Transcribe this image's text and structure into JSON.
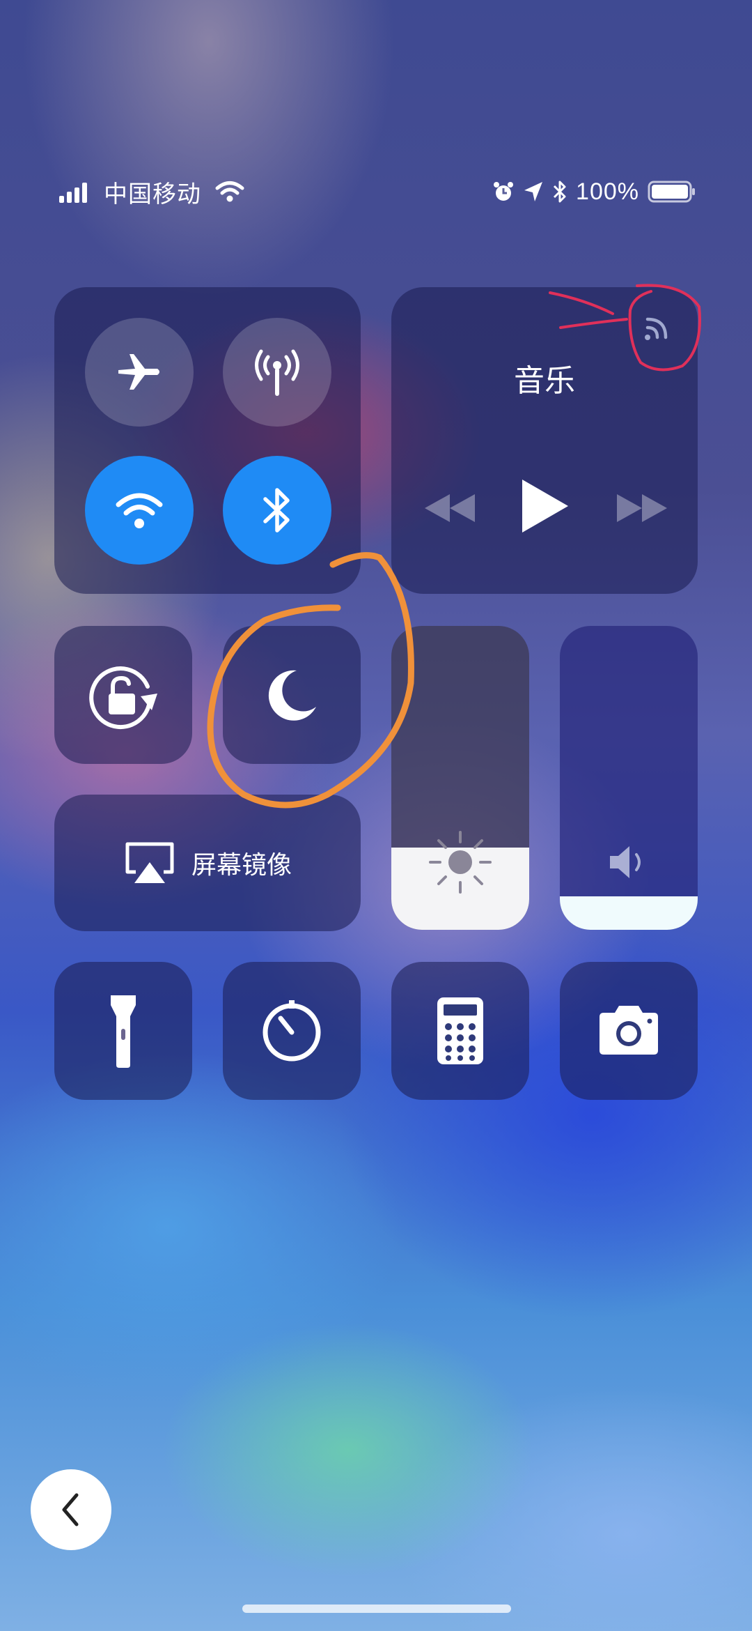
{
  "status_bar": {
    "carrier": "中国移动",
    "battery_percent": "100%",
    "battery_level": 1.0,
    "icons": [
      "signal-icon",
      "wifi-icon",
      "alarm-icon",
      "location-icon",
      "bluetooth-icon",
      "battery-icon"
    ]
  },
  "connectivity": {
    "airplane_mode": {
      "icon": "airplane-icon",
      "state": "off"
    },
    "cellular_data": {
      "icon": "antenna-icon",
      "state": "off"
    },
    "wifi": {
      "icon": "wifi-icon",
      "state": "on"
    },
    "bluetooth": {
      "icon": "bluetooth-icon",
      "state": "on"
    },
    "active_color": "#1f8bf5"
  },
  "music": {
    "title": "音乐",
    "airplay_icon": "airplay-audio-icon",
    "controls": [
      "rewind-icon",
      "play-icon",
      "fast-forward-icon"
    ]
  },
  "controls": {
    "rotation_lock": {
      "icon": "rotation-lock-icon"
    },
    "do_not_disturb": {
      "icon": "moon-icon"
    },
    "screen_mirroring": {
      "label": "屏幕镜像",
      "icon": "screen-mirroring-icon"
    }
  },
  "sliders": {
    "brightness": {
      "icon": "sun-icon",
      "level": 0.27
    },
    "volume": {
      "icon": "speaker-icon",
      "level": 0.11
    }
  },
  "shortcuts": [
    "flashlight-icon",
    "timer-icon",
    "calculator-icon",
    "camera-icon"
  ],
  "annotations": {
    "orange_circle_color": "#f0913a",
    "red_marker_color": "#e0305a"
  }
}
